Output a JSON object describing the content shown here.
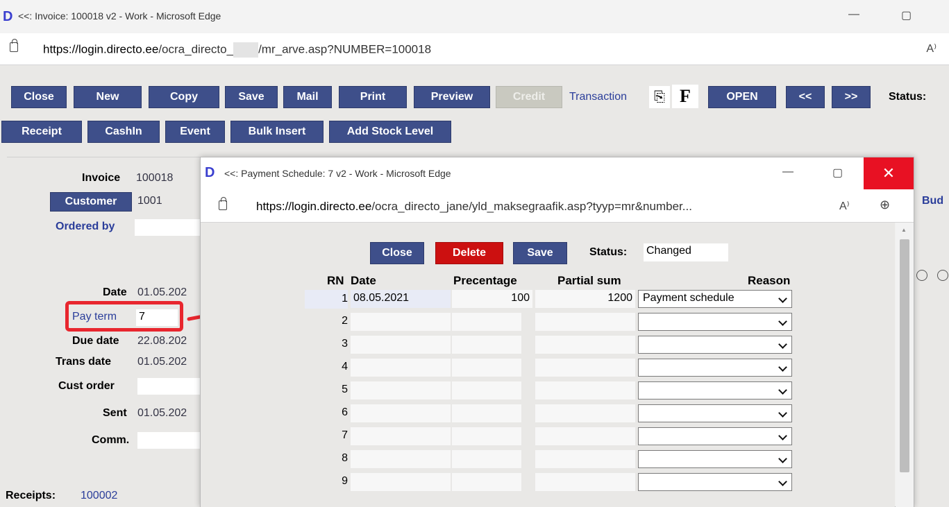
{
  "browser": {
    "title": "<<: Invoice: 100018 v2 - Work - Microsoft Edge",
    "url_domain": "https://login.directo.ee",
    "url_path1": "/ocra_directo_",
    "url_path2": "/mr_arve.asp?NUMBER=100018",
    "minimize": "—",
    "maximize": "▢",
    "read_aloud": "A⁾"
  },
  "toolbar": {
    "row1": [
      "Close",
      "New",
      "Copy",
      "Save",
      "Mail",
      "Print",
      "Preview",
      "Credit"
    ],
    "transaction": "Transaction",
    "f_label": "F",
    "open": "OPEN",
    "prev": "<<",
    "next": ">>",
    "status_label": "Status:",
    "row2": [
      "Receipt",
      "CashIn",
      "Event",
      "Bulk Insert",
      "Add Stock Level"
    ]
  },
  "form": {
    "invoice_label": "Invoice",
    "invoice_value": "100018",
    "customer_label": "Customer",
    "customer_value": "1001",
    "ordered_by": "Ordered by",
    "date_label": "Date",
    "date_value": "01.05.202",
    "pay_term_label": "Pay term",
    "pay_term_value": "7",
    "due_date_label": "Due date",
    "due_date_value": "22.08.202",
    "trans_date_label": "Trans date",
    "trans_date_value": "01.05.202",
    "cust_order_label": "Cust order",
    "sent_label": "Sent",
    "sent_value": "01.05.202",
    "comm_label": "Comm.",
    "receipts_label": "Receipts:",
    "receipts_value": "100002",
    "bud": "Bud"
  },
  "popup": {
    "title": "<<: Payment Schedule: 7 v2 - Work - Microsoft Edge",
    "url_domain": "https://login.directo.ee",
    "url_path": "/ocra_directo_jane/yld_maksegraafik.asp?tyyp=mr&number...",
    "close_x": "✕",
    "minimize": "—",
    "maximize": "▢",
    "read_aloud": "A⁾",
    "zoom": "⊕",
    "buttons": {
      "close": "Close",
      "delete": "Delete",
      "save": "Save"
    },
    "status_label": "Status:",
    "status_value": "Changed",
    "headers": {
      "rn": "RN",
      "date": "Date",
      "percentage": "Precentage",
      "partial_sum": "Partial sum",
      "reason": "Reason"
    },
    "rows": [
      {
        "rn": "1",
        "date": "08.05.2021",
        "percentage": "100",
        "partial_sum": "1200",
        "reason": "Payment schedule"
      },
      {
        "rn": "2",
        "date": "",
        "percentage": "",
        "partial_sum": "",
        "reason": ""
      },
      {
        "rn": "3",
        "date": "",
        "percentage": "",
        "partial_sum": "",
        "reason": ""
      },
      {
        "rn": "4",
        "date": "",
        "percentage": "",
        "partial_sum": "",
        "reason": ""
      },
      {
        "rn": "5",
        "date": "",
        "percentage": "",
        "partial_sum": "",
        "reason": ""
      },
      {
        "rn": "6",
        "date": "",
        "percentage": "",
        "partial_sum": "",
        "reason": ""
      },
      {
        "rn": "7",
        "date": "",
        "percentage": "",
        "partial_sum": "",
        "reason": ""
      },
      {
        "rn": "8",
        "date": "",
        "percentage": "",
        "partial_sum": "",
        "reason": ""
      },
      {
        "rn": "9",
        "date": "",
        "percentage": "",
        "partial_sum": "",
        "reason": ""
      }
    ]
  },
  "colors": {
    "button_blue": "#3e4f8a",
    "delete_red": "#cc1010",
    "highlight_red": "#e8262e",
    "link_blue": "#2a3d9a"
  }
}
